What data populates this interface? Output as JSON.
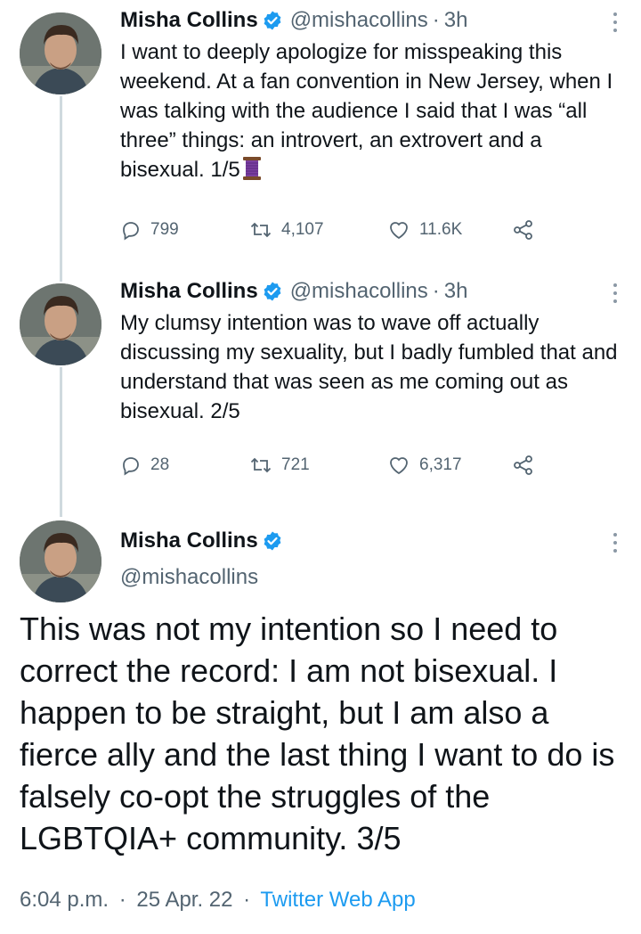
{
  "colors": {
    "verified_badge": "#1d9bf0",
    "secondary_text": "#536471",
    "link": "#1d9bf0",
    "thread_line": "#cfd9de"
  },
  "tweets": [
    {
      "author_name": "Misha Collins",
      "author_handle": "@mishacollins",
      "separator": "·",
      "time": "3h",
      "text": "I want to deeply apologize for misspeaking this weekend. At a fan convention in New Jersey, when I was talking with the audience I said that I was “all three” things: an introvert, an extrovert and a bisexual. 1/5",
      "emoji": "thread-spool-emoji",
      "replies": "799",
      "retweets": "4,107",
      "likes": "11.6K"
    },
    {
      "author_name": "Misha Collins",
      "author_handle": "@mishacollins",
      "separator": "·",
      "time": "3h",
      "text": "My clumsy intention was to wave off actually discussing my sexuality, but I badly fumbled that and understand that was seen as me coming out as bisexual. 2/5",
      "replies": "28",
      "retweets": "721",
      "likes": "6,317"
    }
  ],
  "main_tweet": {
    "author_name": "Misha Collins",
    "author_handle": "@mishacollins",
    "text": "This was not my intention so I need to correct the record: I am not bisexual. I happen to be straight, but I am also a fierce ally and the last thing I want to do is falsely co-opt the struggles of the LGBTQIA+ community. 3/5",
    "time": "6:04 p.m.",
    "separator": "·",
    "date": "25 Apr. 22",
    "source": "Twitter Web App"
  },
  "icons": [
    "verified-badge-icon",
    "more-options-icon",
    "reply-icon",
    "retweet-icon",
    "like-icon",
    "share-icon"
  ]
}
